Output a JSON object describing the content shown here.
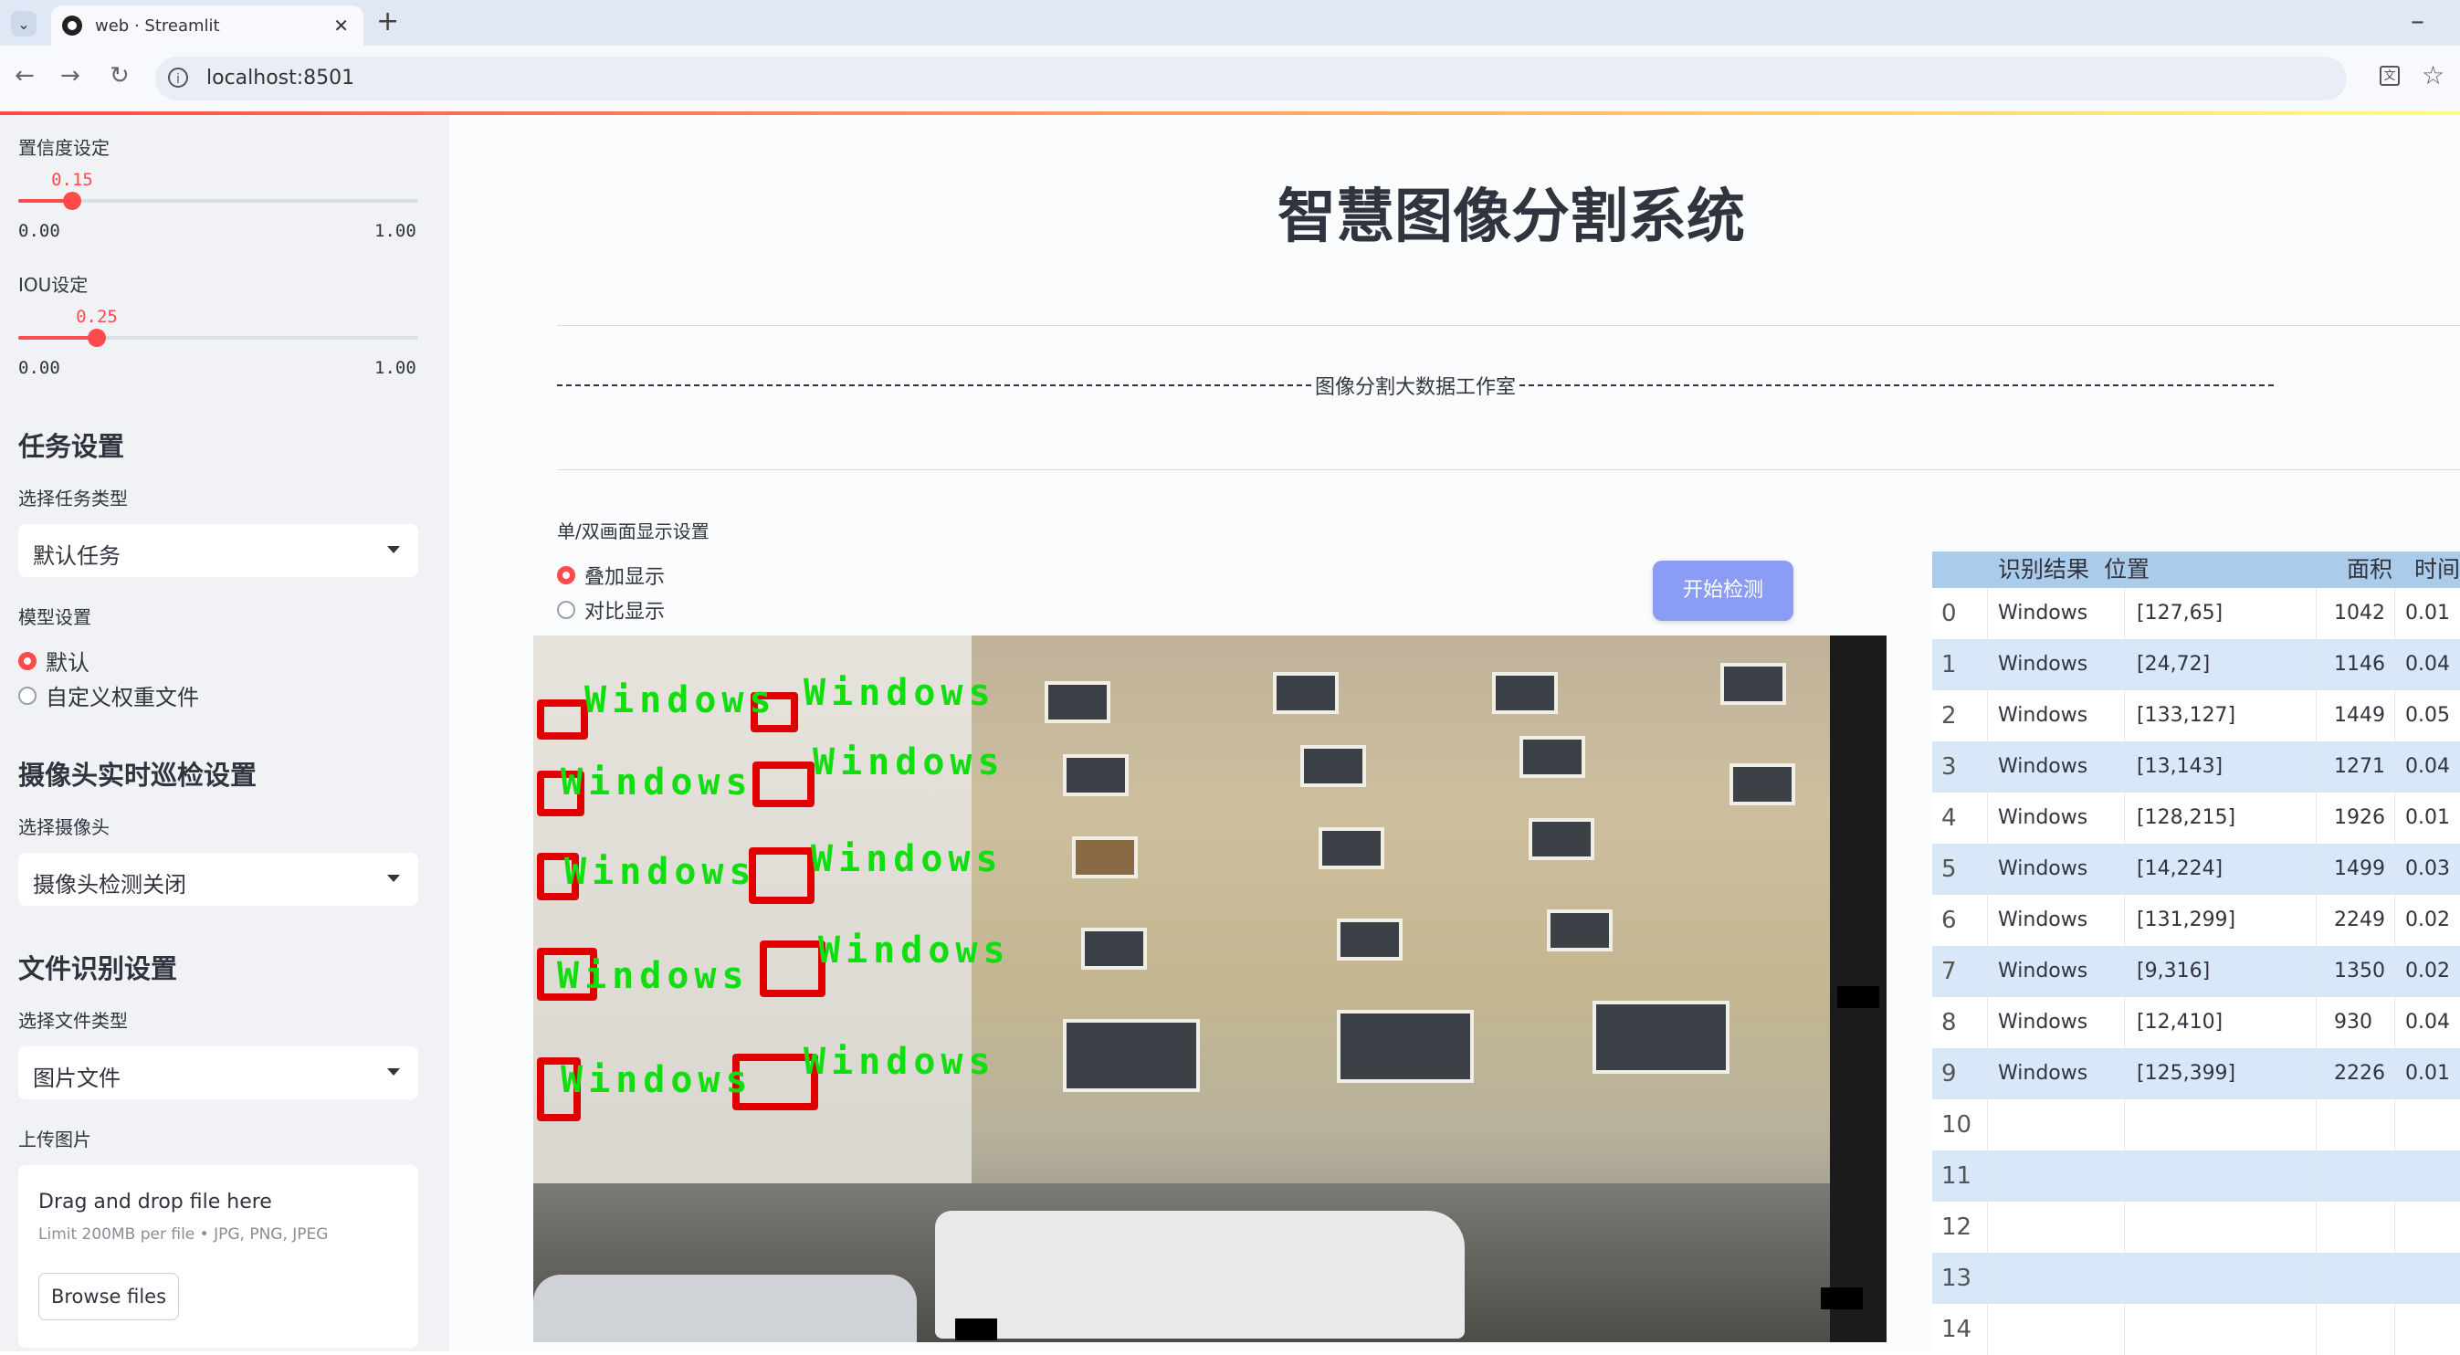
{
  "browser": {
    "tab_title": "web · Streamlit",
    "url": "localhost:8501"
  },
  "sidebar": {
    "confidence": {
      "label": "置信度设定",
      "value": "0.15",
      "min": "0.00",
      "max": "1.00",
      "fraction": 0.15
    },
    "iou": {
      "label": "IOU设定",
      "value": "0.25",
      "min": "0.00",
      "max": "1.00",
      "fraction": 0.25
    },
    "task_section": "任务设置",
    "task_type_label": "选择任务类型",
    "task_type_value": "默认任务",
    "model_label": "模型设置",
    "model_options": [
      "默认",
      "自定义权重文件"
    ],
    "model_selected": 0,
    "camera_section": "摄像头实时巡检设置",
    "camera_label": "选择摄像头",
    "camera_value": "摄像头检测关闭",
    "file_section": "文件识别设置",
    "file_type_label": "选择文件类型",
    "file_type_value": "图片文件",
    "upload_label": "上传图片",
    "upload_title": "Drag and drop file here",
    "upload_limit": "Limit 200MB per file • JPG, PNG, JPEG",
    "upload_button": "Browse files"
  },
  "main": {
    "title": "智慧图像分割系统",
    "subtitle": "图像分割大数据工作室",
    "display_label": "单/双画面显示设置",
    "display_options": [
      "叠加显示",
      "对比显示"
    ],
    "display_selected": 0,
    "start_button": "开始检测",
    "detection_label": "Windows",
    "colors": {
      "accent": "#ff4b4b",
      "button": "#8a9cf4",
      "box": "#e10000",
      "label": "#11dd11"
    }
  },
  "table": {
    "headers": [
      "识别结果",
      "位置",
      "面积",
      "时间"
    ],
    "rows": [
      {
        "idx": "0",
        "name": "Windows",
        "pos": "[127,65]",
        "area": "1042",
        "time": "0.01"
      },
      {
        "idx": "1",
        "name": "Windows",
        "pos": "[24,72]",
        "area": "1146",
        "time": "0.04"
      },
      {
        "idx": "2",
        "name": "Windows",
        "pos": "[133,127]",
        "area": "1449",
        "time": "0.05"
      },
      {
        "idx": "3",
        "name": "Windows",
        "pos": "[13,143]",
        "area": "1271",
        "time": "0.04"
      },
      {
        "idx": "4",
        "name": "Windows",
        "pos": "[128,215]",
        "area": "1926",
        "time": "0.01"
      },
      {
        "idx": "5",
        "name": "Windows",
        "pos": "[14,224]",
        "area": "1499",
        "time": "0.03"
      },
      {
        "idx": "6",
        "name": "Windows",
        "pos": "[131,299]",
        "area": "2249",
        "time": "0.02"
      },
      {
        "idx": "7",
        "name": "Windows",
        "pos": "[9,316]",
        "area": "1350",
        "time": "0.02"
      },
      {
        "idx": "8",
        "name": "Windows",
        "pos": "[12,410]",
        "area": "930",
        "time": "0.04"
      },
      {
        "idx": "9",
        "name": "Windows",
        "pos": "[125,399]",
        "area": "2226",
        "time": "0.01"
      },
      {
        "idx": "10",
        "name": "",
        "pos": "",
        "area": "",
        "time": ""
      },
      {
        "idx": "11",
        "name": "",
        "pos": "",
        "area": "",
        "time": ""
      },
      {
        "idx": "12",
        "name": "",
        "pos": "",
        "area": "",
        "time": ""
      },
      {
        "idx": "13",
        "name": "",
        "pos": "",
        "area": "",
        "time": ""
      },
      {
        "idx": "14",
        "name": "",
        "pos": "",
        "area": "",
        "time": ""
      }
    ]
  }
}
